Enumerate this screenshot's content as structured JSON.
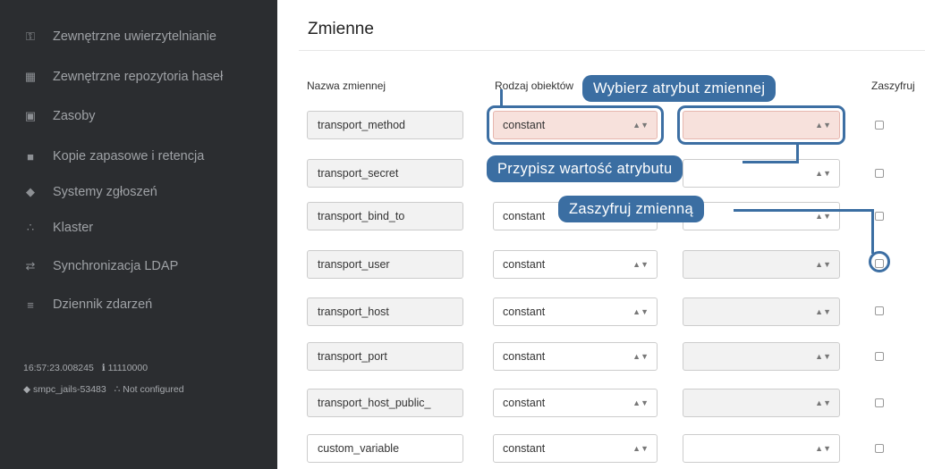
{
  "sidebar": {
    "items": [
      {
        "label": "Zewnętrzne uwierzytelnianie",
        "icon": "key-icon"
      },
      {
        "label": "Zewnętrzne repozytoria haseł",
        "icon": "grid-icon"
      },
      {
        "label": "Zasoby",
        "icon": "image-icon"
      },
      {
        "label": "Kopie zapasowe i retencja",
        "icon": "archive-icon"
      },
      {
        "label": "Systemy zgłoszeń",
        "icon": "tag-icon"
      },
      {
        "label": "Klaster",
        "icon": "sitemap-icon"
      },
      {
        "label": "Synchronizacja LDAP",
        "icon": "exchange-icon"
      },
      {
        "label": "Dziennik zdarzeń",
        "icon": "list-icon"
      }
    ],
    "status": {
      "time": "16:57:23.008245",
      "version": "11110000",
      "host": "smpc_jails-53483",
      "cluster": "Not configured"
    }
  },
  "main": {
    "title": "Zmienne",
    "columns": {
      "name": "Nazwa zmiennej",
      "type": "Rodzaj obiektów",
      "encrypt": "Zaszyfruj"
    },
    "rows": [
      {
        "name": "transport_method",
        "type": "constant"
      },
      {
        "name": "transport_secret",
        "type": ""
      },
      {
        "name": "transport_bind_to",
        "type": "constant"
      },
      {
        "name": "transport_user",
        "type": "constant"
      },
      {
        "name": "transport_host",
        "type": "constant"
      },
      {
        "name": "transport_port",
        "type": "constant"
      },
      {
        "name": "transport_host_public_",
        "type": "constant"
      },
      {
        "name": "custom_variable",
        "type": "constant"
      }
    ]
  },
  "callouts": {
    "attribute": "Wybierz atrybut zmiennej",
    "value": "Przypisz wartość atrybutu",
    "encrypt": "Zaszyfruj zmienną"
  },
  "colors": {
    "sidebar_bg": "#2b2d30",
    "callout": "#3b6ea2",
    "highlight": "#f7e1dc"
  }
}
